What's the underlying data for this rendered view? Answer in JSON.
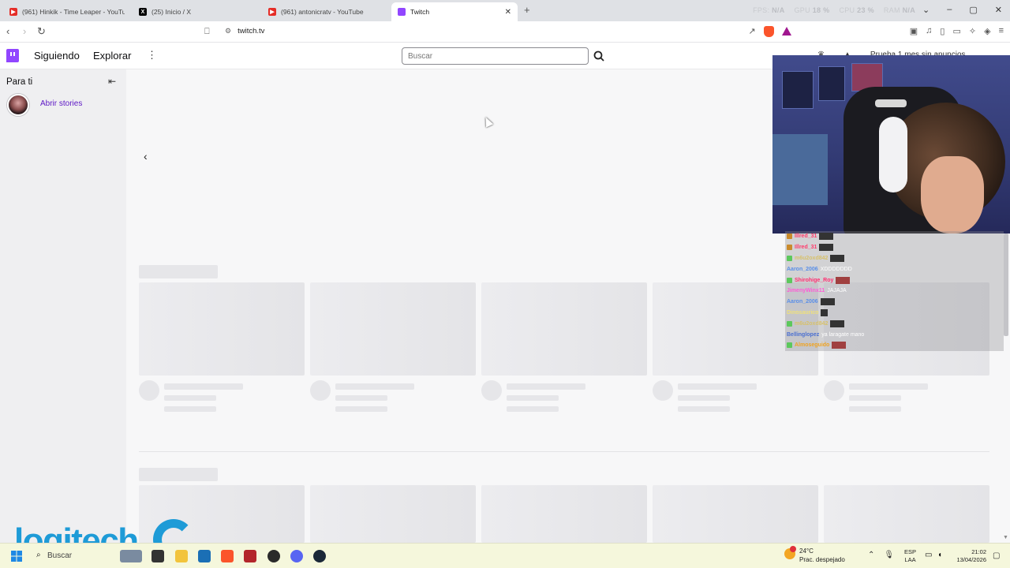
{
  "browser": {
    "tabs": [
      {
        "title": "(961) Hinkik - Time Leaper - YouTube",
        "icon": "youtube-icon"
      },
      {
        "title": "(25) Inicio / X",
        "icon": "x-icon"
      },
      {
        "title": "(961) antonicratv - YouTube",
        "icon": "youtube-icon"
      },
      {
        "title": "Twitch",
        "icon": "twitch-icon",
        "active": true
      }
    ],
    "url": "twitch.tv",
    "perf": {
      "fps_label": "FPS:",
      "fps_value": "N/A",
      "gpu_label": "GPU",
      "gpu_value": "18 %",
      "cpu_label": "CPU",
      "cpu_value": "23 %",
      "ram_label": "RAM",
      "ram_value": "N/A"
    }
  },
  "twitch": {
    "nav": {
      "following": "Siguiendo",
      "explore": "Explorar",
      "search_placeholder": "Buscar",
      "promo": "Prueba 1 mes sin anuncios"
    },
    "sidebar": {
      "title": "Para ti",
      "stories_label": "Abrir stories"
    }
  },
  "stream_overlay": {
    "chat": [
      {
        "user": "Illred_31",
        "color": "#ff3b6b",
        "msg": "",
        "badge": "#c98a2b"
      },
      {
        "user": "Illred_31",
        "color": "#ff3b6b",
        "msg": "",
        "badge": "#c98a2b"
      },
      {
        "user": "m6u2oxd842",
        "color": "#d7c16b",
        "msg": "",
        "badge": "#5cc85c"
      },
      {
        "user": "Aaron_2006",
        "color": "#5a8fe8",
        "msg": "XDDDDDDD",
        "badge": ""
      },
      {
        "user": "Shirohige_Roy",
        "color": "#ff2d6f",
        "msg": "",
        "badge": "#5cc85c"
      },
      {
        "user": "JimenyWinx11",
        "color": "#ff5bd6",
        "msg": "JAJAJA",
        "badge": ""
      },
      {
        "user": "Aaron_2006",
        "color": "#5a8fe8",
        "msg": "",
        "badge": ""
      },
      {
        "user": "Dinosaurico",
        "color": "#f0e17a",
        "msg": "",
        "badge": ""
      },
      {
        "user": "m6u2oxd842",
        "color": "#d7c16b",
        "msg": "",
        "badge": "#5cc85c"
      },
      {
        "user": "Bellinglopez",
        "color": "#4a6fd1",
        "msg": "ya laragate mano",
        "badge": ""
      },
      {
        "user": "Almoseguido",
        "color": "#f0a321",
        "msg": "",
        "badge": "#5cc85c"
      }
    ],
    "logo_text": "logitech"
  },
  "taskbar": {
    "search": "Buscar",
    "weather_temp": "24°C",
    "weather_desc": "Prac. despejado",
    "lang1": "ESP",
    "lang2": "LAA",
    "time": "21:02",
    "date": "13/04/2026"
  },
  "colors": {
    "twitch_purple": "#9146ff",
    "logitech_blue": "#1e9bd7",
    "taskbar_bg": "#f5f7dc"
  }
}
